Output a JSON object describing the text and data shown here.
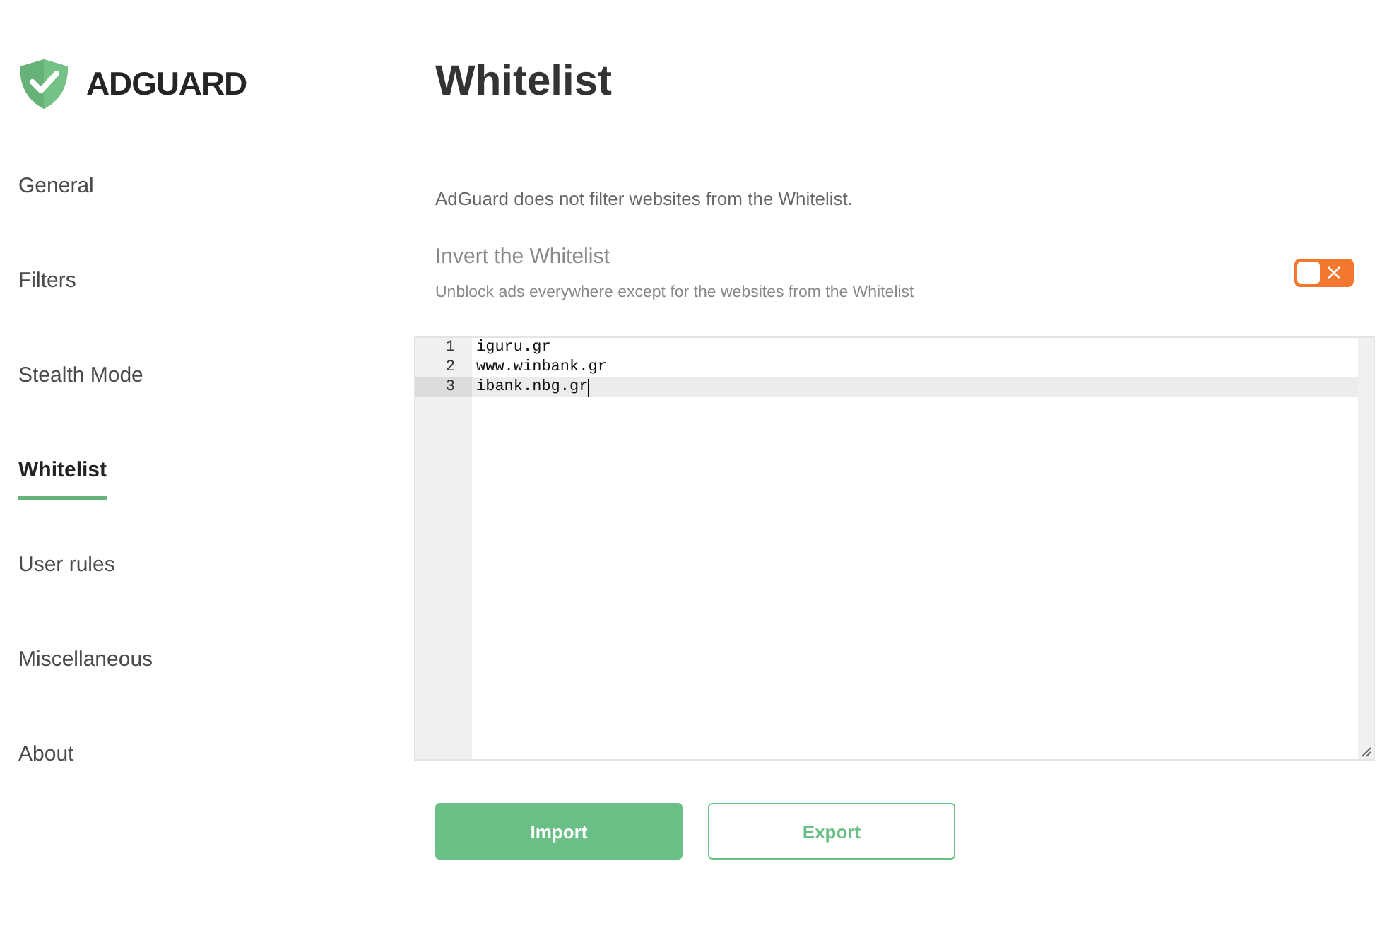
{
  "brand": "ADGUARD",
  "nav": [
    {
      "label": "General",
      "selected": false
    },
    {
      "label": "Filters",
      "selected": false
    },
    {
      "label": "Stealth Mode",
      "selected": false
    },
    {
      "label": "Whitelist",
      "selected": true
    },
    {
      "label": "User rules",
      "selected": false
    },
    {
      "label": "Miscellaneous",
      "selected": false
    },
    {
      "label": "About",
      "selected": false
    }
  ],
  "title": "Whitelist",
  "description": "AdGuard does not filter websites from the Whitelist.",
  "invert": {
    "title": "Invert the Whitelist",
    "subtitle": "Unblock ads everywhere except for the websites from the Whitelist",
    "on": false
  },
  "editor": {
    "lines": [
      {
        "number": "1",
        "text": "iguru.gr",
        "active": false
      },
      {
        "number": "2",
        "text": "www.winbank.gr",
        "active": false
      },
      {
        "number": "3",
        "text": "ibank.nbg.gr",
        "active": true
      }
    ]
  },
  "buttons": [
    {
      "label": "Import",
      "kind": "primary"
    },
    {
      "label": "Export",
      "kind": "outline"
    }
  ]
}
